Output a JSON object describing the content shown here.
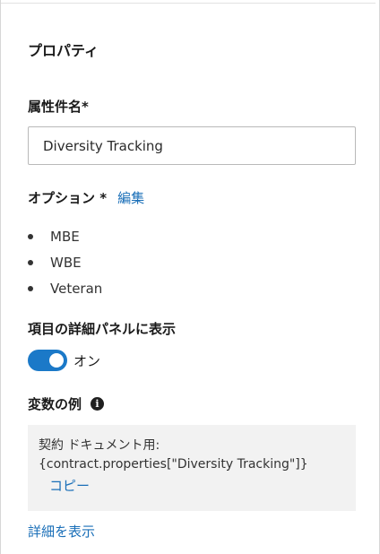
{
  "panel": {
    "heading": "プロパティ"
  },
  "attribute_name": {
    "label": "属性件名*",
    "value": "Diversity Tracking"
  },
  "options": {
    "label": "オプション *",
    "edit_label": "編集",
    "items": [
      "MBE",
      "WBE",
      "Veteran"
    ]
  },
  "detail_panel": {
    "label": "項目の詳細パネルに表示",
    "toggle_state": "on",
    "toggle_label": "オン"
  },
  "variable_example": {
    "label": "変数の例",
    "info_icon": "info-icon",
    "context_line": "契約 ドキュメント用:",
    "code_line": "{contract.properties[\"Diversity Tracking\"]}",
    "copy_label": "コピー"
  },
  "footer": {
    "show_details_label": "詳細を表示"
  },
  "colors": {
    "accent": "#1b79c8",
    "link": "#1a6fb8",
    "box_background": "#f2f2f2"
  }
}
